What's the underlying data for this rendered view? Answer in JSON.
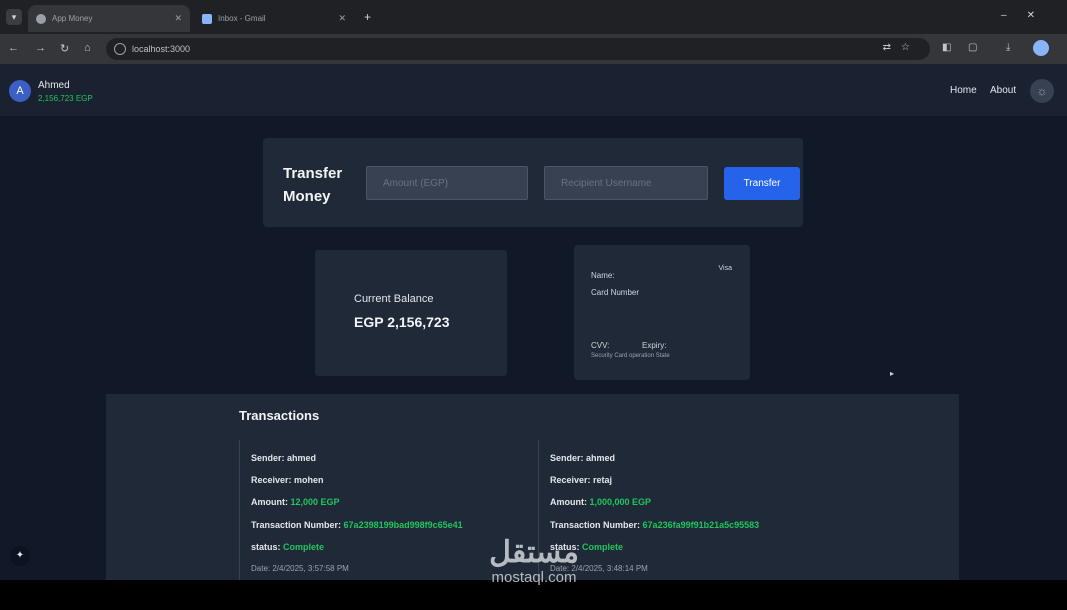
{
  "browser": {
    "tabs": [
      {
        "title": "App Money",
        "active": true
      },
      {
        "title": "Inbox - Gmail",
        "active": false
      }
    ],
    "url": "localhost:3000"
  },
  "header": {
    "avatar_initial": "A",
    "user_name": "Ahmed",
    "user_balance": "2,156,723 EGP",
    "nav": {
      "home": "Home",
      "about": "About"
    }
  },
  "transfer": {
    "title": "Transfer Money",
    "amount_placeholder": "Amount (EGP)",
    "recipient_placeholder": "Recipient Username",
    "button_label": "Transfer"
  },
  "balance": {
    "label": "Current Balance",
    "value": "EGP 2,156,723"
  },
  "card": {
    "name_label": "Name:",
    "brand": "Visa",
    "number_label": "Card Number",
    "cvv_label": "CVV:",
    "expiry_label": "Expiry:",
    "security_note": "Security Card operation State"
  },
  "transactions": {
    "title": "Transactions",
    "labels": {
      "sender": "Sender:",
      "receiver": "Receiver:",
      "amount": "Amount:",
      "number": "Transaction Number:",
      "status": "status:"
    },
    "items": [
      {
        "sender": "ahmed",
        "receiver": "mohen",
        "amount": "12,000 EGP",
        "number": "67a2398199bad998f9c65e41",
        "status": "Complete",
        "date": "Date: 2/4/2025, 3:57:58 PM"
      },
      {
        "sender": "ahmed",
        "receiver": "retaj",
        "amount": "1,000,000 EGP",
        "number": "67a236fa99f91b21a5c95583",
        "status": "Complete",
        "date": "Date: 2/4/2025, 3:48:14 PM"
      }
    ]
  },
  "watermark": {
    "arabic": "مستقل",
    "latin": "mostaql.com"
  },
  "colors": {
    "accent": "#2563eb",
    "positive": "#22c55e",
    "background": "#111827",
    "panel": "#1f2937"
  }
}
